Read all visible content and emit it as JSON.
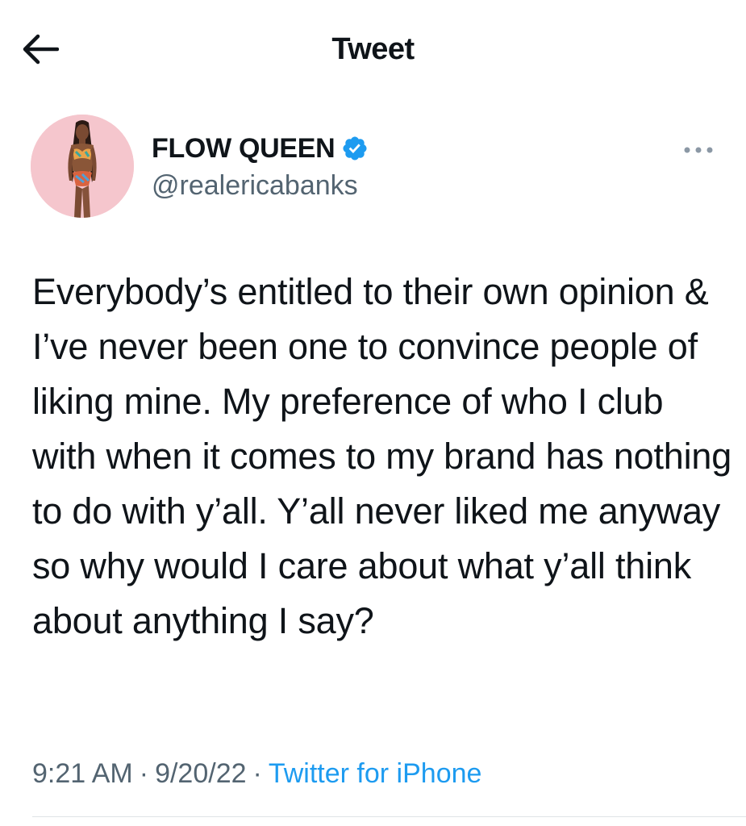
{
  "header": {
    "title": "Tweet",
    "back_icon": "arrow-left-icon"
  },
  "author": {
    "display_name": "FLOW QUEEN",
    "handle": "@realericabanks",
    "verified_icon": "verified-badge-icon",
    "more_icon": "more-horizontal-icon",
    "avatar_icon": "avatar-photo"
  },
  "tweet": {
    "text": "Everybody’s entitled to their own opinion & I’ve never been one to convince people of liking mine. My preference of who I club with when it comes to my brand has nothing to do with y’all. Y’all never liked me anyway so why would I care about what y’all think about anything I say?"
  },
  "meta": {
    "time": "9:21 AM",
    "separator": "·",
    "date": "9/20/22",
    "source": "Twitter for iPhone"
  },
  "colors": {
    "text": "#0f1419",
    "secondary": "#536471",
    "link": "#1d9bf0",
    "verified": "#1d9bf0"
  }
}
